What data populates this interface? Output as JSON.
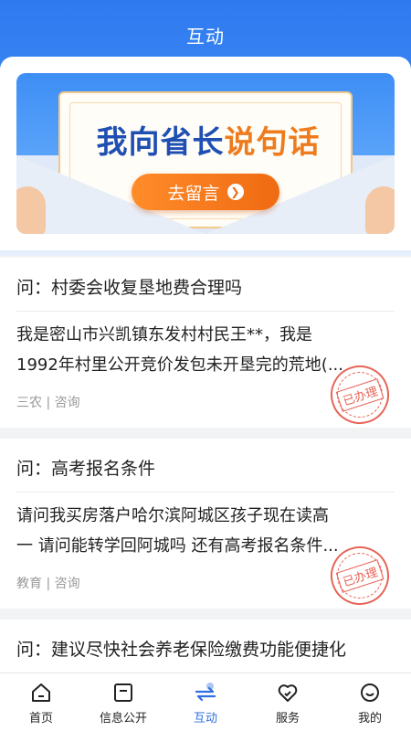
{
  "header": {
    "title": "互动"
  },
  "banner": {
    "title_part1": "我向省长",
    "title_part2": "说句话",
    "cta_label": "去留言"
  },
  "questions": [
    {
      "question": "问：村委会收复垦地费合理吗",
      "body_line1": "我是密山市兴凯镇东发村村民王**，我是",
      "body_line2": "1992年村里公开竞价发包未开垦完的荒地(...",
      "meta": "三农 | 咨询",
      "status": "已办理"
    },
    {
      "question": "问：高考报名条件",
      "body_line1": "请问我买房落户哈尔滨阿城区孩子现在读高",
      "body_line2": "一 请问能转学回阿城吗 还有高考报名条件...",
      "meta": "教育 | 咨询",
      "status": "已办理"
    },
    {
      "question": "问：建议尽快社会养老保险缴费功能便捷化"
    }
  ],
  "tabbar": {
    "items": [
      {
        "label": "首页",
        "icon": "home-icon"
      },
      {
        "label": "信息公开",
        "icon": "info-icon"
      },
      {
        "label": "互动",
        "icon": "interaction-icon",
        "active": true
      },
      {
        "label": "服务",
        "icon": "heart-service-icon"
      },
      {
        "label": "我的",
        "icon": "profile-icon"
      }
    ]
  },
  "colors": {
    "primary": "#2f7af0",
    "accent": "#f06a12",
    "stamp": "#e24a3a",
    "active_tab": "#2f6fe0"
  }
}
